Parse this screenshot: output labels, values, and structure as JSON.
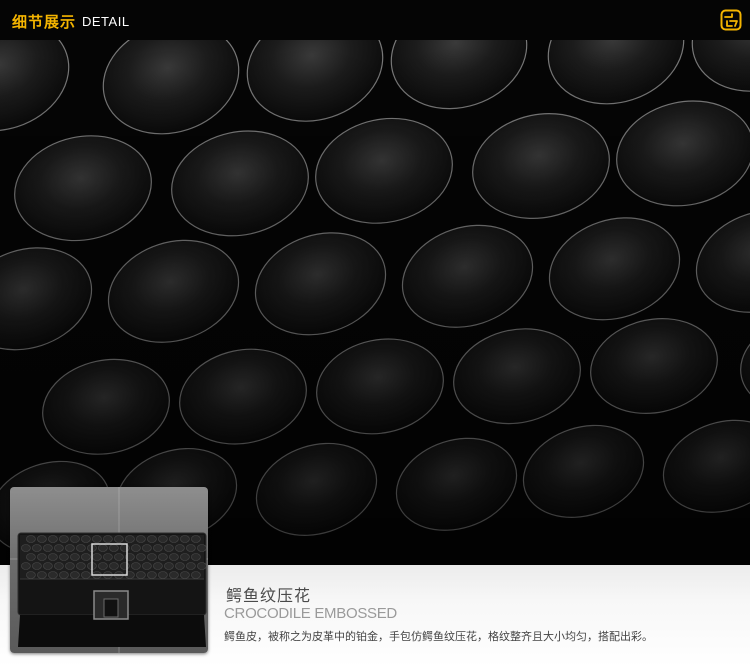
{
  "header": {
    "title_cn": "细节展示",
    "title_en": "DETAIL",
    "logo_icon": "brand-logo-icon",
    "accent_color": "#f4b400"
  },
  "caption": {
    "title_cn": "鳄鱼纹压花",
    "title_en": "CROCODILE EMBOSSED",
    "description": "鳄鱼皮，被称之为皮革中的铂金，手包仿鳄鱼纹压花，格纹整齐且大小均匀，搭配出彩。"
  },
  "thumbnail": {
    "subject": "black-crocodile-wallet",
    "highlight_color": "#cfcfcf"
  }
}
